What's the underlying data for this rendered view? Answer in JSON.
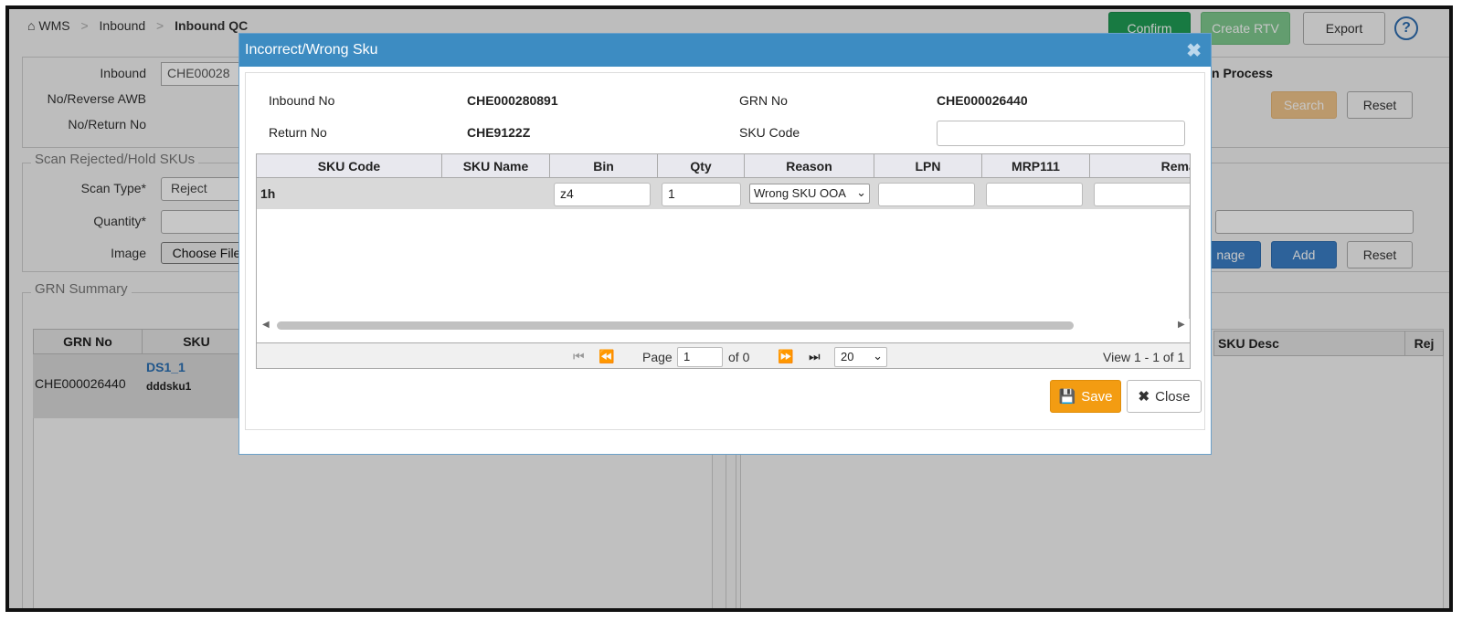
{
  "breadcrumb": {
    "home_icon": "home-icon",
    "items": [
      "WMS",
      "Inbound",
      "Inbound QC"
    ]
  },
  "header_buttons": {
    "confirm": "Confirm",
    "create_rtv": "Create RTV",
    "export": "Export",
    "help": "?"
  },
  "filters": {
    "inbound_label": "Inbound",
    "inbound_value": "CHE00028",
    "awb_label": "No/Reverse AWB",
    "return_label": "No/Return No",
    "process_text": "n Process",
    "search": "Search",
    "reset": "Reset"
  },
  "scan_section": {
    "legend": "Scan Rejected/Hold SKUs",
    "scan_type_label": "Scan Type*",
    "scan_type_value": "Reject",
    "quantity_label": "Quantity*",
    "image_label": "Image",
    "choose_file": "Choose File",
    "image_btn": "nage",
    "add": "Add",
    "reset": "Reset"
  },
  "grn_summary": {
    "legend": "GRN Summary",
    "col_grn": "GRN No",
    "col_sku": "SKU",
    "grn_value": "CHE000026440",
    "sku_link": "DS1_1",
    "sku_sub": "dddsku1",
    "right_col_desc": "SKU Desc",
    "right_col_rej": "Rej"
  },
  "modal": {
    "title": "Incorrect/Wrong Sku",
    "inbound_no_label": "Inbound No",
    "inbound_no_value": "CHE000280891",
    "grn_no_label": "GRN No",
    "grn_no_value": "CHE000026440",
    "return_no_label": "Return No",
    "return_no_value": "CHE9122Z",
    "sku_code_label": "SKU Code",
    "sku_code_value": "",
    "columns": [
      "SKU Code",
      "SKU Name",
      "Bin",
      "Qty",
      "Reason",
      "LPN",
      "MRP111",
      "Remark"
    ],
    "row": {
      "sku_code": "1h",
      "sku_name": "",
      "bin": "z4",
      "qty": "1",
      "reason": "Wrong SKU OOA",
      "lpn": "",
      "mrp": "",
      "remark": ""
    },
    "pager": {
      "page_label": "Page",
      "page_value": "1",
      "of_label": "of 0",
      "page_size": "20",
      "view_text": "View 1 - 1 of 1"
    },
    "save": "Save",
    "close": "Close"
  }
}
